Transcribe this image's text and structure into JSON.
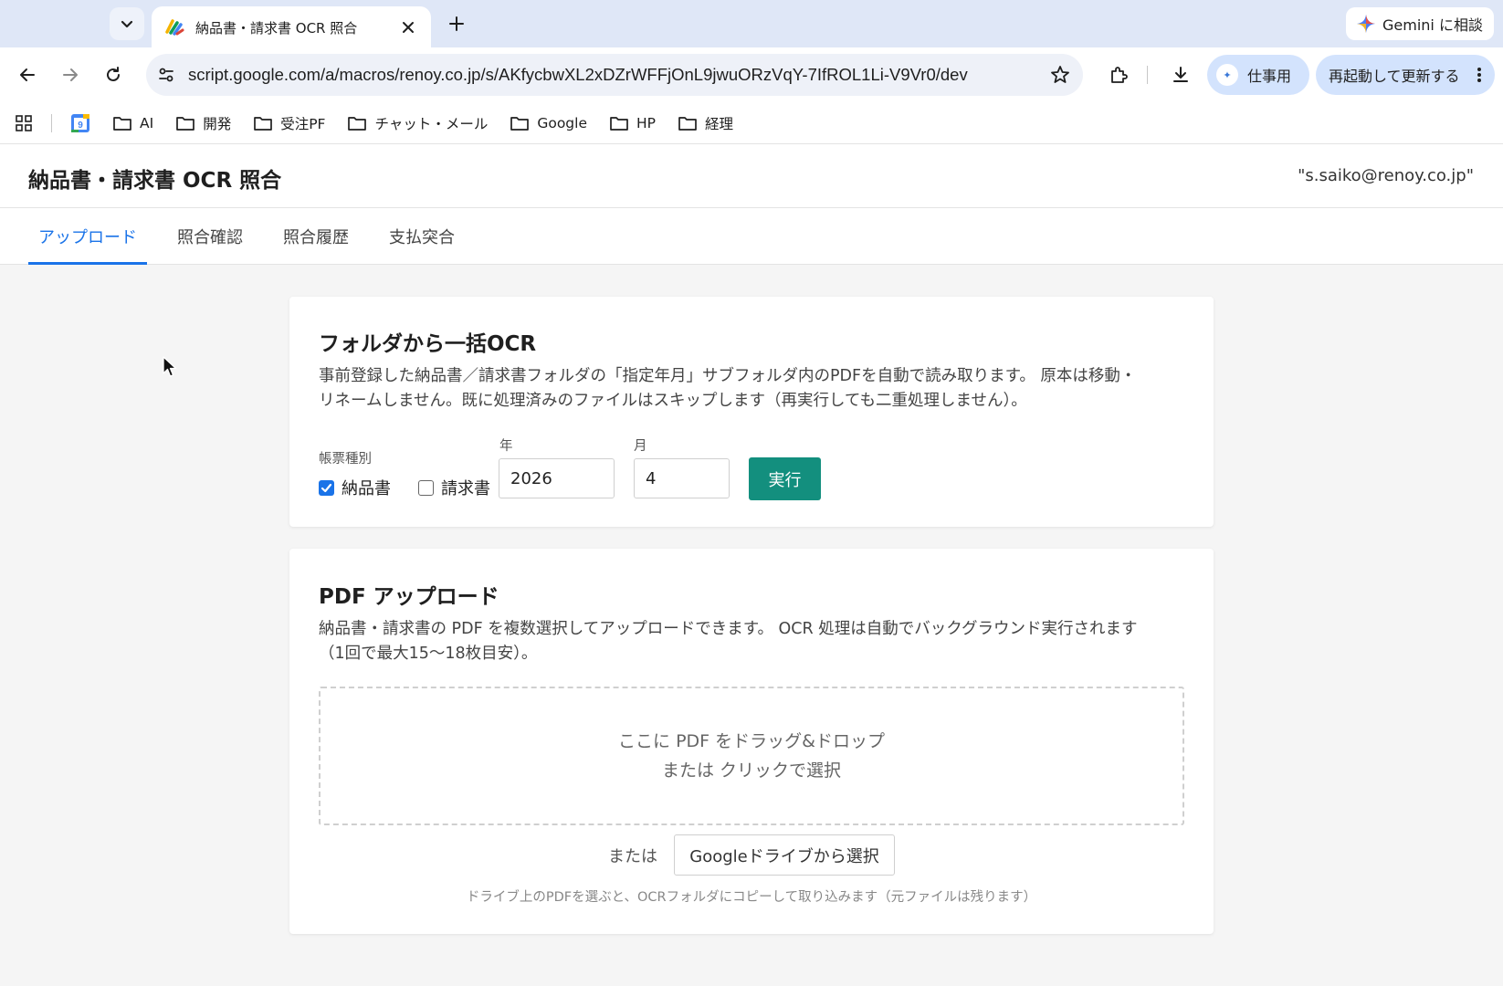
{
  "browser": {
    "tab_title": "納品書・請求書 OCR 照合",
    "gemini_label": "Gemini に相談",
    "url": "script.google.com/a/macros/renoy.co.jp/s/AKfycbwXL2xDZrWFFjOnL9jwuORzVqY-7IfROL1Li-V9Vr0/dev",
    "profile_label": "仕事用",
    "update_label": "再起動して更新する",
    "bookmarks": [
      {
        "label": "AI"
      },
      {
        "label": "開発"
      },
      {
        "label": "受注PF"
      },
      {
        "label": "チャット・メール"
      },
      {
        "label": "Google"
      },
      {
        "label": "HP"
      },
      {
        "label": "経理"
      }
    ],
    "calendar_day": "9"
  },
  "app": {
    "title": "納品書・請求書 OCR 照合",
    "user_email": "\"s.saiko@renoy.co.jp\"",
    "tabs": [
      {
        "label": "アップロード",
        "active": true
      },
      {
        "label": "照合確認",
        "active": false
      },
      {
        "label": "照合履歴",
        "active": false
      },
      {
        "label": "支払突合",
        "active": false
      }
    ],
    "accent_color": "#1a73e8",
    "run_button_color": "#138f7e"
  },
  "folder_ocr": {
    "title": "フォルダから一括OCR",
    "description_line1": "事前登録した納品書／請求書フォルダの「指定年月」サブフォルダ内のPDFを自動で読み取ります。 原本は移動・",
    "description_line2": "リネームしません。既に処理済みのファイルはスキップします（再実行しても二重処理しません）。",
    "doc_type_label": "帳票種別",
    "doc_types": [
      {
        "label": "納品書",
        "checked": true
      },
      {
        "label": "請求書",
        "checked": false
      }
    ],
    "year_label": "年",
    "year_value": "2026",
    "month_label": "月",
    "month_value": "4",
    "run_label": "実行"
  },
  "pdf_upload": {
    "title": "PDF アップロード",
    "description_line1": "納品書・請求書の PDF を複数選択してアップロードできます。 OCR 処理は自動でバックグラウンド実行されます",
    "description_line2": "（1回で最大15〜18枚目安）。",
    "dropzone_line1": "ここに PDF をドラッグ&ドロップ",
    "dropzone_line2": "または クリックで選択",
    "or_label": "または",
    "drive_button_label": "Googleドライブから選択",
    "hint": "ドライブ上のPDFを選ぶと、OCRフォルダにコピーして取り込みます（元ファイルは残ります）"
  }
}
